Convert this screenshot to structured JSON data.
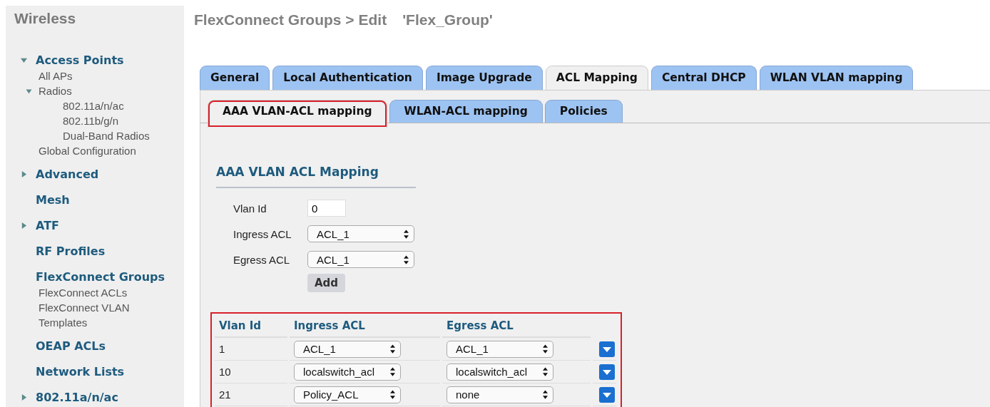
{
  "sidebar": {
    "title": "Wireless",
    "items": [
      {
        "label": "Access Points",
        "kind": "expandable",
        "expanded": true,
        "children": [
          {
            "label": "All APs"
          },
          {
            "label": "Radios",
            "expanded": true,
            "children": [
              {
                "label": "802.11a/n/ac"
              },
              {
                "label": "802.11b/g/n"
              },
              {
                "label": "Dual-Band Radios"
              }
            ]
          },
          {
            "label": "Global Configuration"
          }
        ]
      },
      {
        "label": "Advanced",
        "kind": "expandable",
        "expanded": false
      },
      {
        "label": "Mesh",
        "kind": "plain"
      },
      {
        "label": "ATF",
        "kind": "expandable",
        "expanded": false
      },
      {
        "label": "RF Profiles",
        "kind": "plain"
      },
      {
        "label": "FlexConnect Groups",
        "kind": "plain",
        "children": [
          {
            "label": "FlexConnect ACLs"
          },
          {
            "label": "FlexConnect VLAN Templates"
          }
        ]
      },
      {
        "label": "OEAP ACLs",
        "kind": "plain"
      },
      {
        "label": "Network Lists",
        "kind": "plain"
      },
      {
        "label": "802.11a/n/ac",
        "kind": "expandable",
        "expanded": false
      }
    ]
  },
  "page": {
    "title": "FlexConnect Groups > Edit",
    "group_name": "'Flex_Group'"
  },
  "tabs": [
    {
      "label": "General",
      "selected": false
    },
    {
      "label": "Local Authentication",
      "selected": false
    },
    {
      "label": "Image Upgrade",
      "selected": false
    },
    {
      "label": "ACL Mapping",
      "selected": true
    },
    {
      "label": "Central DHCP",
      "selected": false
    },
    {
      "label": "WLAN VLAN mapping",
      "selected": false
    }
  ],
  "subtabs": [
    {
      "label": "AAA VLAN-ACL mapping",
      "selected": true,
      "highlighted": true
    },
    {
      "label": "WLAN-ACL mapping",
      "selected": false,
      "highlighted": false
    },
    {
      "label": "Policies",
      "selected": false,
      "highlighted": false
    }
  ],
  "section_title": "AAA VLAN ACL Mapping",
  "form": {
    "vlan_id": {
      "label": "Vlan Id",
      "value": "0"
    },
    "ingress_acl": {
      "label": "Ingress ACL",
      "value": "ACL_1"
    },
    "egress_acl": {
      "label": "Egress ACL",
      "value": "ACL_1"
    },
    "add_button": "Add"
  },
  "table": {
    "highlighted": true,
    "columns": [
      "Vlan Id",
      "Ingress ACL",
      "Egress ACL"
    ],
    "rows": [
      {
        "vlan_id": "1",
        "ingress_acl": "ACL_1",
        "egress_acl": "ACL_1"
      },
      {
        "vlan_id": "10",
        "ingress_acl": "localswitch_acl",
        "egress_acl": "localswitch_acl"
      },
      {
        "vlan_id": "21",
        "ingress_acl": "Policy_ACL",
        "egress_acl": "none"
      }
    ]
  }
}
